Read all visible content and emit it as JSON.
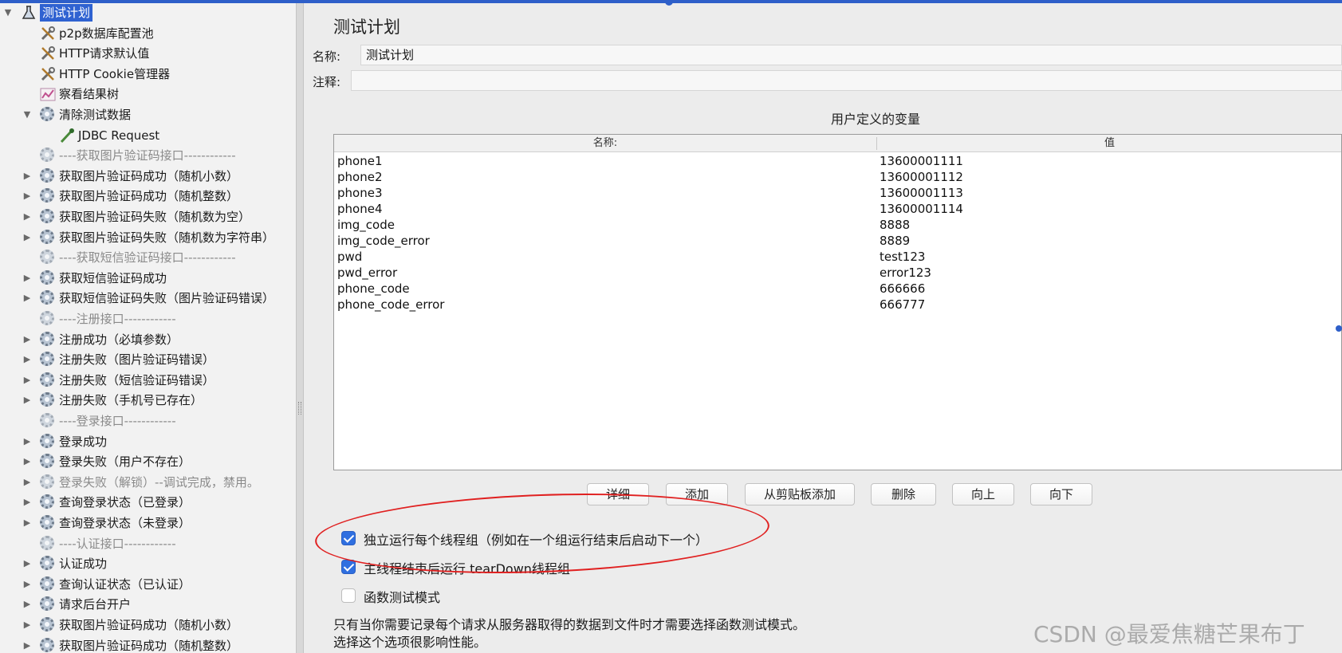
{
  "tree": {
    "items": [
      {
        "label": "测试计划",
        "indent": 0,
        "arrow": "▼",
        "icon": "flask-icon",
        "selected": true
      },
      {
        "label": "p2p数据库配置池",
        "indent": 1,
        "arrow": "",
        "icon": "wrench-icon"
      },
      {
        "label": "HTTP请求默认值",
        "indent": 1,
        "arrow": "",
        "icon": "wrench-icon"
      },
      {
        "label": "HTTP Cookie管理器",
        "indent": 1,
        "arrow": "",
        "icon": "wrench-icon"
      },
      {
        "label": "察看结果树",
        "indent": 1,
        "arrow": "",
        "icon": "chart-icon"
      },
      {
        "label": "清除测试数据",
        "indent": 1,
        "arrow": "▼",
        "icon": "gear-icon"
      },
      {
        "label": "JDBC Request",
        "indent": 2,
        "arrow": "",
        "icon": "pipette-icon"
      },
      {
        "label": "----获取图片验证码接口------------",
        "indent": 1,
        "arrow": "",
        "icon": "gear-icon",
        "sep": true
      },
      {
        "label": "获取图片验证码成功（随机小数）",
        "indent": 1,
        "arrow": "▶",
        "icon": "gear-icon"
      },
      {
        "label": "获取图片验证码成功（随机整数）",
        "indent": 1,
        "arrow": "▶",
        "icon": "gear-icon"
      },
      {
        "label": "获取图片验证码失败（随机数为空）",
        "indent": 1,
        "arrow": "▶",
        "icon": "gear-icon"
      },
      {
        "label": "获取图片验证码失败（随机数为字符串）",
        "indent": 1,
        "arrow": "▶",
        "icon": "gear-icon"
      },
      {
        "label": "----获取短信验证码接口------------",
        "indent": 1,
        "arrow": "",
        "icon": "gear-icon",
        "sep": true
      },
      {
        "label": "获取短信验证码成功",
        "indent": 1,
        "arrow": "▶",
        "icon": "gear-icon"
      },
      {
        "label": "获取短信验证码失败（图片验证码错误）",
        "indent": 1,
        "arrow": "▶",
        "icon": "gear-icon"
      },
      {
        "label": "----注册接口------------",
        "indent": 1,
        "arrow": "",
        "icon": "gear-icon",
        "sep": true
      },
      {
        "label": "注册成功（必填参数）",
        "indent": 1,
        "arrow": "▶",
        "icon": "gear-icon"
      },
      {
        "label": "注册失败（图片验证码错误）",
        "indent": 1,
        "arrow": "▶",
        "icon": "gear-icon"
      },
      {
        "label": "注册失败（短信验证码错误）",
        "indent": 1,
        "arrow": "▶",
        "icon": "gear-icon"
      },
      {
        "label": "注册失败（手机号已存在）",
        "indent": 1,
        "arrow": "▶",
        "icon": "gear-icon"
      },
      {
        "label": "----登录接口------------",
        "indent": 1,
        "arrow": "",
        "icon": "gear-icon",
        "sep": true
      },
      {
        "label": "登录成功",
        "indent": 1,
        "arrow": "▶",
        "icon": "gear-icon"
      },
      {
        "label": "登录失败（用户不存在）",
        "indent": 1,
        "arrow": "▶",
        "icon": "gear-icon"
      },
      {
        "label": "登录失败（解锁）--调试完成，禁用。",
        "indent": 1,
        "arrow": "▶",
        "icon": "gear-icon",
        "disabled": true
      },
      {
        "label": "查询登录状态（已登录）",
        "indent": 1,
        "arrow": "▶",
        "icon": "gear-icon"
      },
      {
        "label": "查询登录状态（未登录）",
        "indent": 1,
        "arrow": "▶",
        "icon": "gear-icon"
      },
      {
        "label": "----认证接口------------",
        "indent": 1,
        "arrow": "",
        "icon": "gear-icon",
        "sep": true
      },
      {
        "label": "认证成功",
        "indent": 1,
        "arrow": "▶",
        "icon": "gear-icon"
      },
      {
        "label": "查询认证状态（已认证）",
        "indent": 1,
        "arrow": "▶",
        "icon": "gear-icon"
      },
      {
        "label": "请求后台开户",
        "indent": 1,
        "arrow": "▶",
        "icon": "gear-icon"
      },
      {
        "label": "获取图片验证码成功（随机小数）",
        "indent": 1,
        "arrow": "▶",
        "icon": "gear-icon"
      },
      {
        "label": "获取图片验证码成功（随机整数）",
        "indent": 1,
        "arrow": "▶",
        "icon": "gear-icon"
      }
    ]
  },
  "panel": {
    "title": "测试计划",
    "name_label": "名称:",
    "name_value": "测试计划",
    "comment_label": "注释:",
    "comment_value": "",
    "vars_title": "用户定义的变量",
    "table": {
      "headers": [
        "名称:",
        "值"
      ],
      "rows": [
        [
          "phone1",
          "13600001111"
        ],
        [
          "phone2",
          "13600001112"
        ],
        [
          "phone3",
          "13600001113"
        ],
        [
          "phone4",
          "13600001114"
        ],
        [
          "img_code",
          "8888"
        ],
        [
          "img_code_error",
          "8889"
        ],
        [
          "pwd",
          "test123"
        ],
        [
          "pwd_error",
          "error123"
        ],
        [
          "phone_code",
          "666666"
        ],
        [
          "phone_code_error",
          "666777"
        ]
      ]
    },
    "buttons": {
      "detail": "详细",
      "add": "添加",
      "add_clipboard": "从剪贴板添加",
      "delete": "删除",
      "up": "向上",
      "down": "向下"
    },
    "options": {
      "run_groups_label": "独立运行每个线程组（例如在一个组运行结束后启动下一个）",
      "run_groups_checked": true,
      "teardown_label": "主线程结束后运行 tearDown线程组",
      "teardown_checked": true,
      "functional_label": "函数测试模式",
      "functional_checked": false
    },
    "note_line1": "只有当你需要记录每个请求从服务器取得的数据到文件时才需要选择函数测试模式。",
    "note_line2": "选择这个选项很影响性能。"
  },
  "watermark": "CSDN @最爱焦糖芒果布丁",
  "colors": {
    "selection": "#2f62d1",
    "checkbox": "#2f6fe0",
    "annotation": "#e02020"
  }
}
